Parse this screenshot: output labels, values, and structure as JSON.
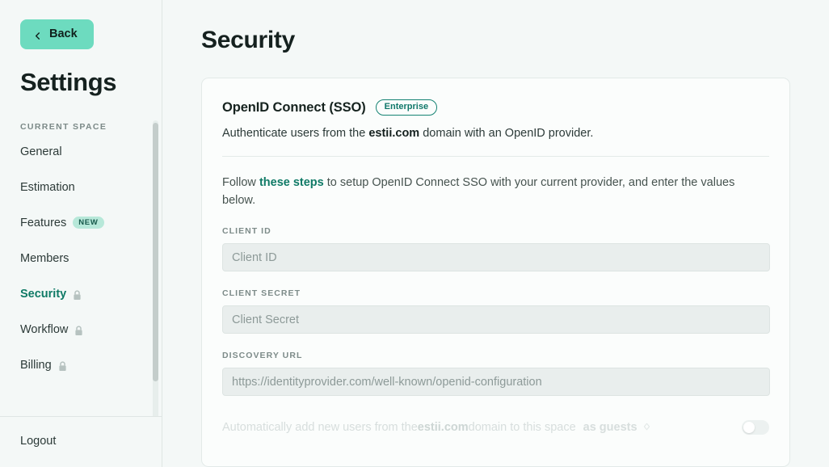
{
  "sidebar": {
    "back_label": "Back",
    "title": "Settings",
    "section_label": "CURRENT SPACE",
    "items": [
      {
        "label": "General",
        "badge": null,
        "locked": false,
        "active": false
      },
      {
        "label": "Estimation",
        "badge": null,
        "locked": false,
        "active": false
      },
      {
        "label": "Features",
        "badge": "NEW",
        "locked": false,
        "active": false
      },
      {
        "label": "Members",
        "badge": null,
        "locked": false,
        "active": false
      },
      {
        "label": "Security",
        "badge": null,
        "locked": true,
        "active": true
      },
      {
        "label": "Workflow",
        "badge": null,
        "locked": true,
        "active": false
      },
      {
        "label": "Billing",
        "badge": null,
        "locked": true,
        "active": false
      }
    ],
    "logout_label": "Logout"
  },
  "main": {
    "page_title": "Security",
    "card": {
      "title": "OpenID Connect (SSO)",
      "badge": "Enterprise",
      "subtitle_pre": "Authenticate users from the ",
      "subtitle_domain": "estii.com",
      "subtitle_post": " domain with an OpenID provider.",
      "instructions_pre": "Follow ",
      "instructions_link": "these steps",
      "instructions_post": " to setup OpenID Connect SSO with your current provider, and enter the values below.",
      "fields": [
        {
          "label": "CLIENT ID",
          "placeholder": "Client ID",
          "value": ""
        },
        {
          "label": "CLIENT SECRET",
          "placeholder": "Client Secret",
          "value": ""
        },
        {
          "label": "DISCOVERY URL",
          "placeholder": "https://identityprovider.com/well-known/openid-configuration",
          "value": ""
        }
      ],
      "auto_add": {
        "text_pre": "Automatically add new users from the ",
        "domain": "estii.com",
        "text_post": " domain to this space",
        "role_select": "as guests",
        "toggle_on": false
      }
    }
  },
  "colors": {
    "accent_green": "#6ddbbf",
    "teal_text": "#0f7a66",
    "badge_new_bg": "#b7e8d9",
    "app_bg": "#f4f8f7",
    "card_bg": "#fbfdfc",
    "input_bg": "#e9eeed"
  }
}
